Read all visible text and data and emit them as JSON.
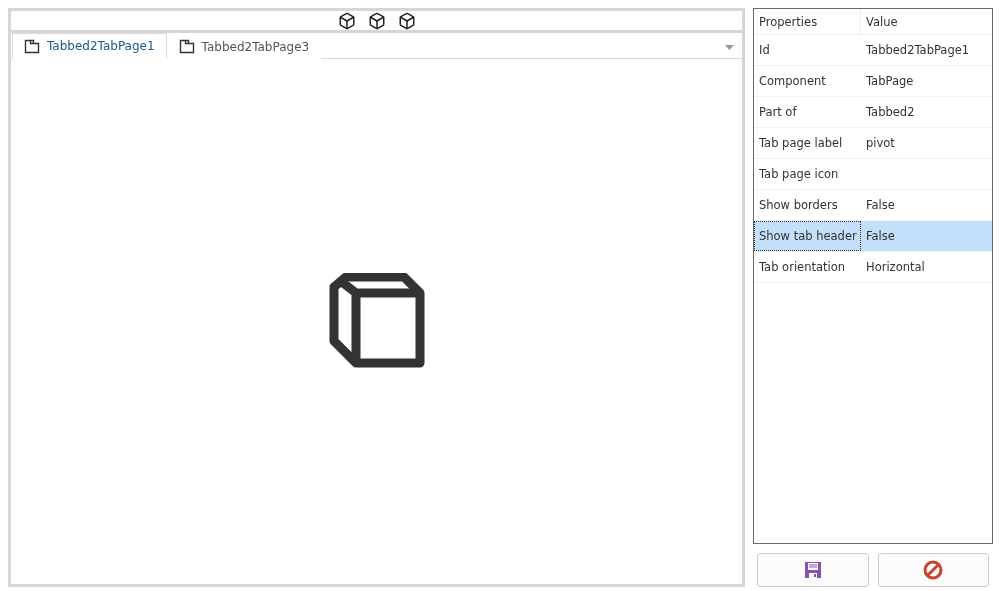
{
  "tabs": [
    {
      "label": "Tabbed2TabPage1",
      "selected": true
    },
    {
      "label": "Tabbed2TabPage3",
      "selected": false
    }
  ],
  "properties": {
    "columns": [
      "Properties",
      "Value"
    ],
    "rows": [
      {
        "name": "Id",
        "value": "Tabbed2TabPage1",
        "selected": false
      },
      {
        "name": "Component",
        "value": "TabPage",
        "selected": false
      },
      {
        "name": "Part of",
        "value": "Tabbed2",
        "selected": false
      },
      {
        "name": "Tab page label",
        "value": "pivot",
        "selected": false
      },
      {
        "name": "Tab page icon",
        "value": "",
        "selected": false
      },
      {
        "name": "Show borders",
        "value": "False",
        "selected": false
      },
      {
        "name": "Show tab header",
        "value": "False",
        "selected": true
      },
      {
        "name": "Tab orientation",
        "value": "Horizontal",
        "selected": false
      }
    ]
  }
}
